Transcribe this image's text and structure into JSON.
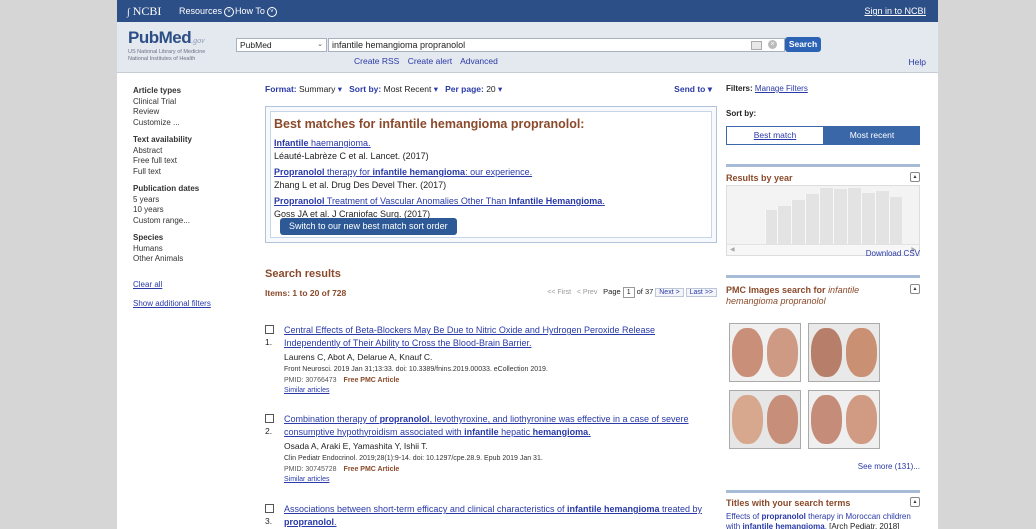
{
  "topbar": {
    "brand": "NCBI",
    "resources": "Resources",
    "howto": "How To",
    "signin": "Sign in to NCBI"
  },
  "header": {
    "logo_pub": "Pub",
    "logo_med": "Med",
    "logo_gov": ".gov",
    "logo_sub1": "US National Library of Medicine",
    "logo_sub2": "National Institutes of Health",
    "database": "PubMed",
    "search_term": "infantile hemangioma propranolol",
    "search_button": "Search",
    "links": [
      "Create RSS",
      "Create alert",
      "Advanced"
    ],
    "help": "Help"
  },
  "sidebar": {
    "groups": [
      {
        "heading": "Article types",
        "items": [
          "Clinical Trial",
          "Review",
          "Customize ..."
        ]
      },
      {
        "heading": "Text availability",
        "items": [
          "Abstract",
          "Free full text",
          "Full text"
        ]
      },
      {
        "heading": "Publication dates",
        "items": [
          "5 years",
          "10 years",
          "Custom range..."
        ]
      },
      {
        "heading": "Species",
        "items": [
          "Humans",
          "Other Animals"
        ]
      }
    ],
    "clear_all": "Clear all",
    "show_filters": "Show additional filters"
  },
  "format_bar": {
    "format_label": "Format:",
    "format_value": "Summary",
    "sort_label": "Sort by:",
    "sort_value": "Most Recent",
    "perpage_label": "Per page:",
    "perpage_value": "20",
    "send_to": "Send to"
  },
  "best_matches": {
    "title": "Best matches for infantile hemangioma propranolol:",
    "switch_button": "Switch to our new best match sort order"
  },
  "results": {
    "heading": "Search results",
    "items_label": "Items: 1 to 20 of 728",
    "pager": {
      "first": "<< First",
      "prev": "< Prev",
      "page_label": "Page",
      "page": "1",
      "of": "of 37",
      "next": "Next >",
      "last": "Last >>"
    },
    "list": [
      {
        "num": "1.",
        "authors": "Laurens C, Abot A, Delarue A, Knauf C.",
        "citation": "Front Neurosci. 2019 Jan 31;13:33. doi: 10.3389/fnins.2019.00033. eCollection 2019.",
        "pmid": "PMID: 30766473",
        "free": "Free PMC Article",
        "similar": "Similar articles"
      },
      {
        "num": "2.",
        "authors": "Osada A, Araki E, Yamashita Y, Ishii T.",
        "citation": "Clin Pediatr Endocrinol. 2019;28(1):9-14. doi: 10.1297/cpe.28.9. Epub 2019 Jan 31.",
        "pmid": "PMID: 30745728",
        "free": "Free PMC Article",
        "similar": "Similar articles"
      },
      {
        "num": "3."
      }
    ]
  },
  "right": {
    "filters_label": "Filters:",
    "manage_filters": "Manage Filters",
    "sortby_label": "Sort by:",
    "best_match": "Best match",
    "most_recent": "Most recent",
    "results_by_year": "Results by year",
    "download_csv": "Download CSV",
    "pmc_title": "PMC Images search for",
    "pmc_query": "infantile hemangioma propranolol",
    "see_more": "See more (131)...",
    "titles_heading": "Titles with your search terms"
  }
}
